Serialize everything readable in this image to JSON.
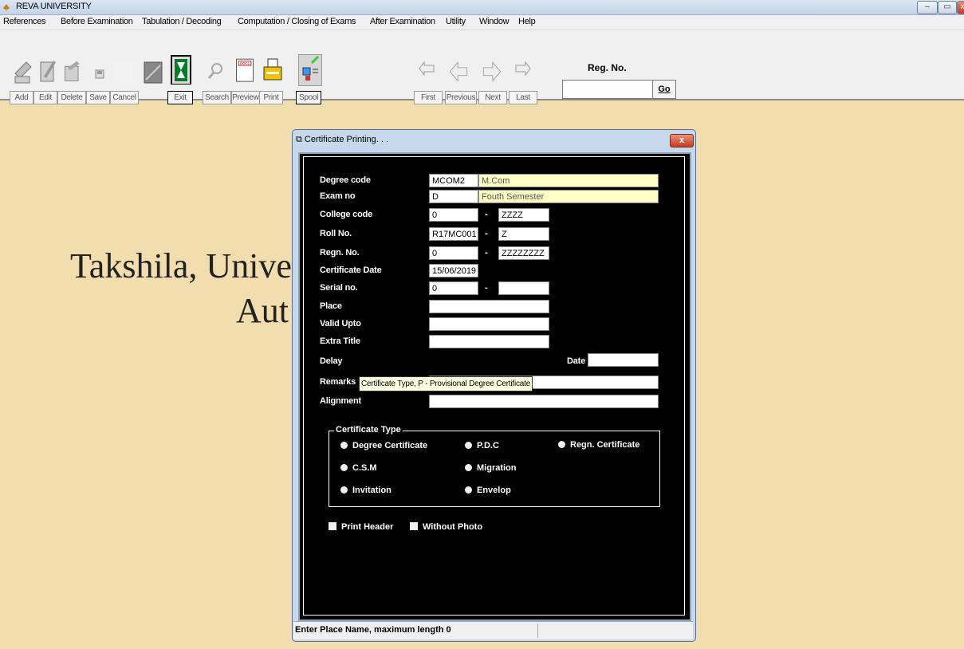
{
  "window": {
    "title": "REVA UNIVERSITY",
    "min": "–",
    "max": "▭",
    "close": "x"
  },
  "menu": [
    "References",
    "Before Examination",
    "Tabulation / Decoding",
    "Computation / Closing of Exams",
    "After Examination",
    "Utility",
    "Window",
    "Help"
  ],
  "toolbar": {
    "buttons": [
      "Add",
      "Edit",
      "Delete",
      "Save",
      "Cancel",
      "Exit",
      "Search",
      "Preview",
      "Print",
      "Spool",
      "First",
      "Previous",
      "Next",
      "Last"
    ],
    "preview_icon_text": "DOC1",
    "regno_label": "Reg. No.",
    "go_label": "Go"
  },
  "background": {
    "line1": "Takshila, Unive",
    "line2": "Aut"
  },
  "dialog": {
    "title": "Certificate Printing. . .",
    "close": "x",
    "fields": {
      "degree_code": {
        "label": "Degree code",
        "value": "MCOM2",
        "desc": "M.Com"
      },
      "exam_no": {
        "label": "Exam no",
        "value": "D",
        "desc": "Fouth Semester"
      },
      "college_code": {
        "label": "College code",
        "value": "0",
        "desc": "ZZZZ"
      },
      "roll_no": {
        "label": "Roll No.",
        "value": "R17MC001",
        "desc": "Z"
      },
      "regn_no": {
        "label": "Regn. No.",
        "value": "0",
        "desc": "ZZZZZZZZ"
      },
      "certificate_date": {
        "label": "Certificate Date",
        "value": "15/06/2019"
      },
      "serial_no": {
        "label": "Serial no.",
        "value": "0",
        "desc": ""
      },
      "place": {
        "label": "Place",
        "value": ""
      },
      "valid_upto": {
        "label": "Valid Upto",
        "value": ""
      },
      "extra_title": {
        "label": "Extra Title",
        "value": ""
      },
      "delay": {
        "label": "Delay",
        "date_label": "Date",
        "date_value": ""
      },
      "remarks": {
        "label": "Remarks",
        "value": ""
      },
      "alignment": {
        "label": "Alignment",
        "value": ""
      }
    },
    "dash": "-",
    "tooltip": "Certificate Type, P - Provisional Degree Certificate",
    "certificate_type": {
      "legend": "Certificate Type",
      "options": [
        "Degree Certificate",
        "P.D.C",
        "Regn. Certificate",
        "C.S.M",
        "Migration",
        "Invitation",
        "Envelop"
      ]
    },
    "checkboxes": [
      "Print Header",
      "Without Photo"
    ],
    "status": "Enter Place Name, maximum length 0"
  }
}
